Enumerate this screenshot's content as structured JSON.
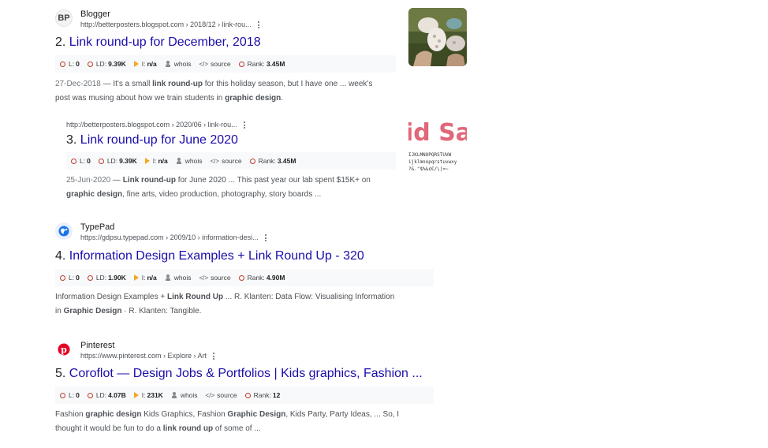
{
  "results": [
    {
      "site_name": "Blogger",
      "favicon_text": "BP",
      "url": "http://betterposters.blogspot.com › 2018/12 › link-rou...",
      "number": "2.",
      "title": "Link round-up for December, 2018",
      "seo": {
        "l": "0",
        "ld": "9.39K",
        "i": "n/a",
        "whois": "whois",
        "source": "source",
        "rank": "3.45M"
      },
      "date": "27-Dec-2018",
      "snippet": [
        {
          "t": " — It's a small "
        },
        {
          "t": "link round-up",
          "b": true
        },
        {
          "t": " for this holiday season, but I have one ... week's post was musing about how we train students in "
        },
        {
          "t": "graphic design",
          "b": true
        },
        {
          "t": "."
        }
      ]
    },
    {
      "site_name": "",
      "url": "http://betterposters.blogspot.com › 2020/06 › link-rou...",
      "number": "3.",
      "title": "Link round-up for June 2020",
      "seo": {
        "l": "0",
        "ld": "9.39K",
        "i": "n/a",
        "whois": "whois",
        "source": "source",
        "rank": "3.45M"
      },
      "date": "25-Jun-2020",
      "snippet": [
        {
          "t": " — "
        },
        {
          "t": "Link round-up",
          "b": true
        },
        {
          "t": " for June 2020 ... This past year our lab spent $15K+ on "
        },
        {
          "t": "graphic design",
          "b": true
        },
        {
          "t": ", fine arts, video production, photography, story boards ..."
        }
      ]
    },
    {
      "site_name": "TypePad",
      "url": "https://gdpsu.typepad.com › 2009/10 › information-desi...",
      "number": "4.",
      "title": "Information Design Examples + Link Round Up - 320",
      "seo": {
        "l": "0",
        "ld": "1.90K",
        "i": "n/a",
        "whois": "whois",
        "source": "source",
        "rank": "4.90M"
      },
      "date": "",
      "snippet": [
        {
          "t": "Information Design Examples + "
        },
        {
          "t": "Link Round Up",
          "b": true
        },
        {
          "t": " ... R. Klanten: Data Flow: Visualising Information in "
        },
        {
          "t": "Graphic Design",
          "b": true
        },
        {
          "t": " · R. Klanten: Tangible."
        }
      ]
    },
    {
      "site_name": "Pinterest",
      "url": "https://www.pinterest.com › Explore › Art",
      "number": "5.",
      "title": "Coroflot — Design Jobs & Portfolios | Kids graphics, Fashion ...",
      "seo": {
        "l": "0",
        "ld": "4.07B",
        "i": "231K",
        "whois": "whois",
        "source": "source",
        "rank": "12"
      },
      "date": "",
      "snippet": [
        {
          "t": "Fashion "
        },
        {
          "t": "graphic design",
          "b": true
        },
        {
          "t": " Kids Graphics, Fashion "
        },
        {
          "t": "Graphic Design",
          "b": true
        },
        {
          "t": ", Kids Party, Party Ideas, ... So, I thought it would be fun to do a "
        },
        {
          "t": "link round up",
          "b": true
        },
        {
          "t": " of some of ..."
        }
      ]
    }
  ],
  "seo_labels": {
    "l": "L:",
    "ld": "LD:",
    "i": "I:",
    "rank": "Rank:"
  },
  "thumb2_text": {
    "big": "id Sa",
    "line1": "IJKLMNOPQRSTUVW",
    "line2": "ijklmnopqrstuvwxy",
    "line3": "?&.\"$%&¢€/\\|=~"
  },
  "colors": {
    "link": "#1a0dab",
    "seo_circle": "#c0392b",
    "seo_play": "#f5a623"
  }
}
